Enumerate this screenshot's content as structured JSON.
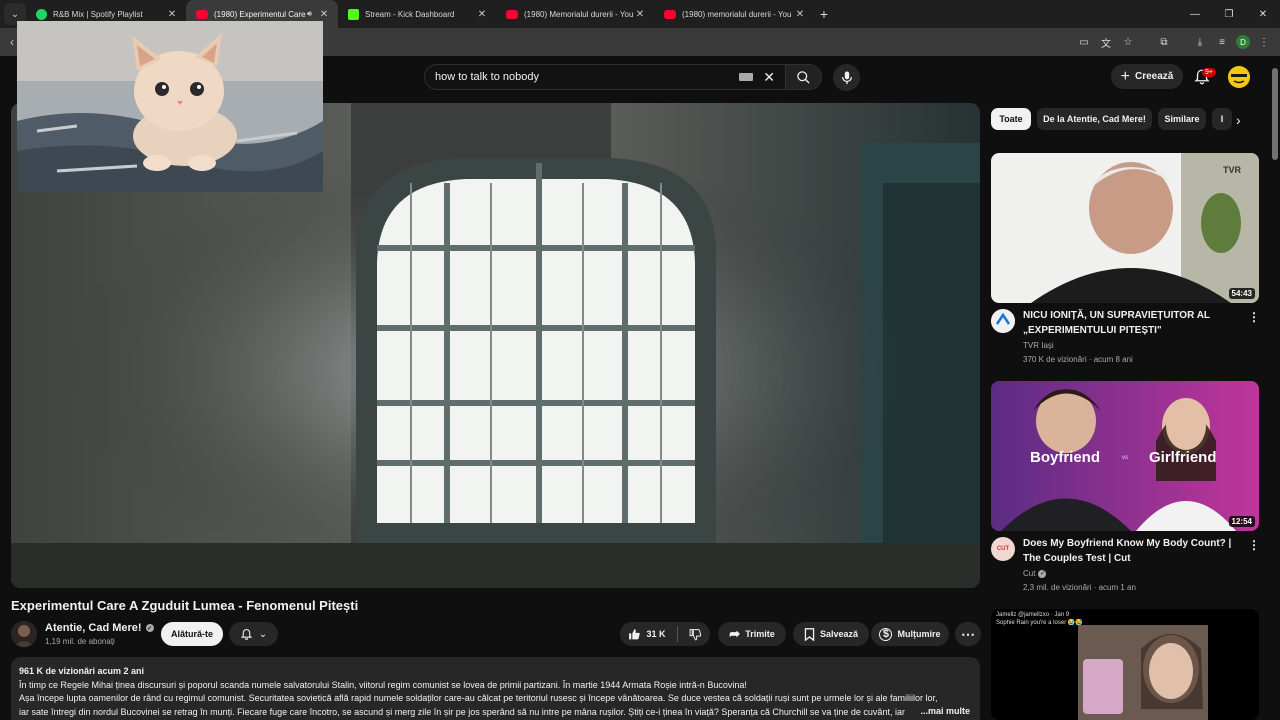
{
  "browser": {
    "tabs": [
      {
        "title": "R&B Mix | Spotify Playlist",
        "favicon": "spotify-icon",
        "active": false
      },
      {
        "title": "(1980) Experimentul Care A",
        "favicon": "youtube-icon",
        "active": true
      },
      {
        "title": "Stream - Kick Dashboard",
        "favicon": "kick-icon",
        "active": false
      },
      {
        "title": "(1980) Memorialul durerii - You",
        "favicon": "youtube-icon",
        "active": false
      },
      {
        "title": "(1980) memorialul durerii - You",
        "favicon": "youtube-icon",
        "active": false
      }
    ],
    "profile_initial": "D"
  },
  "header": {
    "search_query": "how to talk to nobody",
    "create_label": "Creează",
    "notifications_count": "9+"
  },
  "video": {
    "title": "Experimentul Care A Zguduit Lumea - Fenomenul Pitești",
    "channel_name": "Atentie, Cad Mere!",
    "subscribers": "1,19 mil. de abonați",
    "join_label": "Alătură-te",
    "likes": "31 K",
    "share_label": "Trimite",
    "save_label": "Salvează",
    "thanks_label": "Mulțumire"
  },
  "description": {
    "stats": "961 K de vizionări  acum 2 ani",
    "line1": "În timp ce Regele Mihai ținea discursuri și poporul scanda numele salvatorului Stalin, viitorul regim comunist se lovea de primii partizani. În martie 1944 Armata Roșie intră-n Bucovina!",
    "line2": "Așa începe lupta oamenilor de rând cu regimul comunist. Securitatea sovietică află rapid numele soldaților care-au călcat pe teritoriul rusesc și începe vânătoarea. Se duce vestea că soldații ruși sunt pe urmele lor și ale familiilor lor,",
    "line3": "iar sate întregi din nordul Bucovinei se retrag în munți. Fiecare fuge care încotro, se ascund și merg zile în șir pe jos sperând să nu intre pe mâna rușilor. Știți ce-i ținea în viață? Speranța că Churchill se va ține de cuvânt, iar",
    "more_label": "...mai multe"
  },
  "chips": [
    "Toate",
    "De la Atentie, Cad Mere!",
    "Similare",
    "I"
  ],
  "recommendations": [
    {
      "title": "NICU IONIȚĂ, UN SUPRAVIEȚUITOR AL „EXPERIMENTULUI PITEȘTI\"",
      "channel": "TVR Iași",
      "meta": "370 K de vizionări · acum 8 ani",
      "duration": "54:43",
      "thumb_logo": "TVR IAȘI",
      "verified": false
    },
    {
      "title": "Does My Boyfriend Know My Body Count? | The Couples Test | Cut",
      "channel": "Cut",
      "meta": "2,3 mil. de vizionări · acum 1 an",
      "duration": "12:54",
      "thumb_left": "Boyfriend",
      "thumb_right": "Girlfriend",
      "thumb_vs": "vs",
      "avatar_text": "CUT",
      "verified": true
    },
    {
      "thumb_caption_user": "Jamellz @jamellzxo · Jan 9",
      "thumb_caption_text": "Sophie Rain you're a loser 😭😭"
    }
  ],
  "colors": {
    "background": "#0f0f0f",
    "surface": "#272727",
    "text": "#f1f1f1",
    "muted": "#aaaaaa",
    "accent_red": "#ff0033"
  }
}
